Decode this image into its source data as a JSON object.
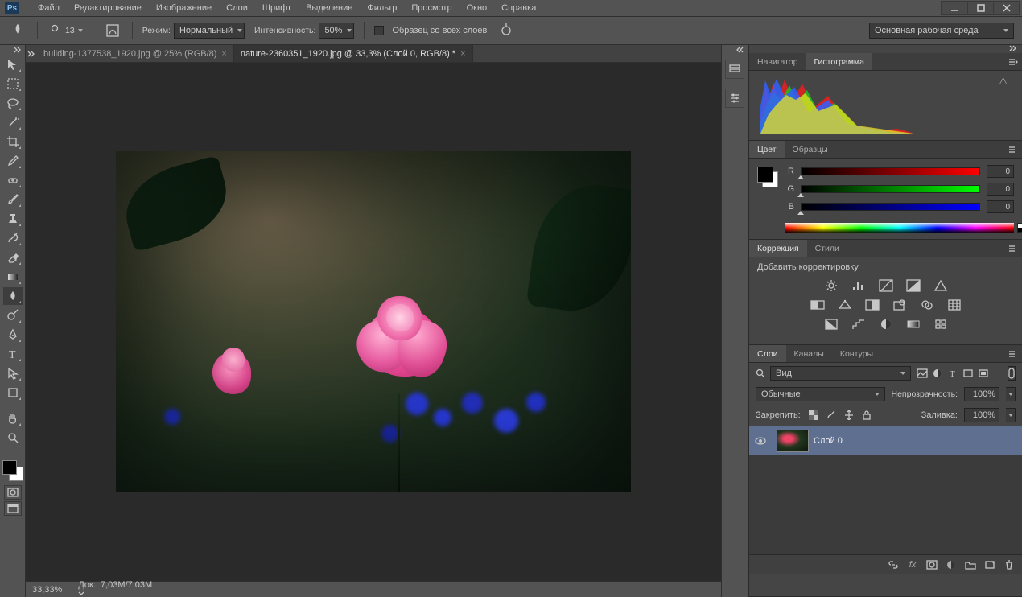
{
  "app_shortname": "Ps",
  "menu": [
    "Файл",
    "Редактирование",
    "Изображение",
    "Слои",
    "Шрифт",
    "Выделение",
    "Фильтр",
    "Просмотр",
    "Окно",
    "Справка"
  ],
  "options": {
    "brush_size": "13",
    "mode_label": "Режим:",
    "mode_value": "Нормальный",
    "intensity_label": "Интенсивность:",
    "intensity_value": "50%",
    "sample_all_label": "Образец со всех слоев",
    "workspace": "Основная рабочая среда"
  },
  "doc_tabs": [
    {
      "title": "building-1377538_1920.jpg @ 25% (RGB/8)",
      "active": false
    },
    {
      "title": "nature-2360351_1920.jpg @ 33,3% (Слой 0, RGB/8) *",
      "active": true
    }
  ],
  "status": {
    "zoom": "33,33%",
    "docsize_label": "Док:",
    "docsize": "7,03M/7,03M"
  },
  "panels": {
    "nav_tabs": [
      "Навигатор",
      "Гистограмма"
    ],
    "nav_active": 1,
    "color_tabs": [
      "Цвет",
      "Образцы"
    ],
    "color_active": 0,
    "rgb": {
      "labels": [
        "R",
        "G",
        "B"
      ],
      "values": [
        "0",
        "0",
        "0"
      ]
    },
    "adj_tabs": [
      "Коррекция",
      "Стили"
    ],
    "adj_active": 0,
    "adj_title": "Добавить корректировку",
    "layers_tabs": [
      "Слои",
      "Каналы",
      "Контуры"
    ],
    "layers_active": 0,
    "filter_label": "Вид",
    "blend_value": "Обычные",
    "opacity_label": "Непрозрачность:",
    "opacity_value": "100%",
    "lock_label": "Закрепить:",
    "fill_label": "Заливка:",
    "fill_value": "100%",
    "layer0_name": "Слой 0"
  }
}
